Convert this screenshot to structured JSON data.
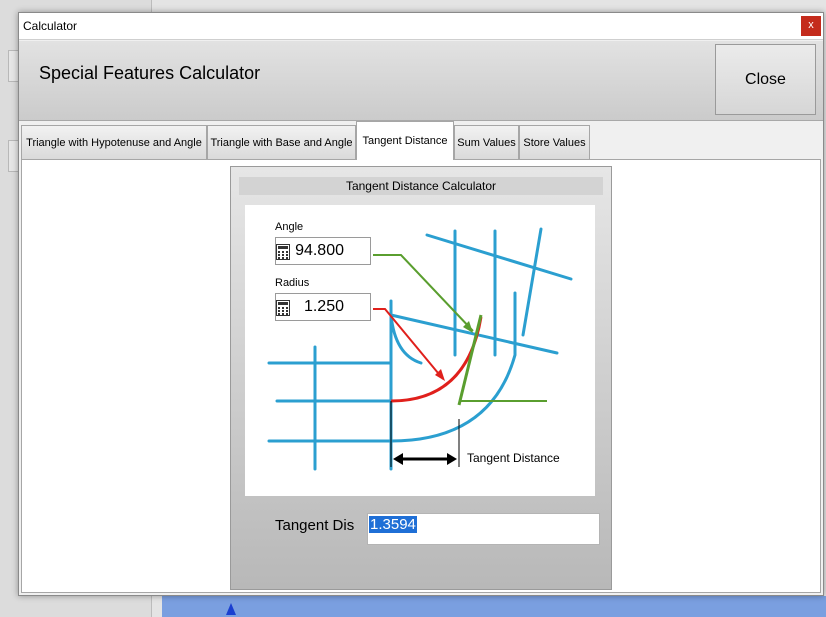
{
  "window": {
    "title": "Calculator",
    "close_glyph": "x"
  },
  "header": {
    "heading": "Special Features Calculator",
    "close_label": "Close"
  },
  "tabs": [
    {
      "label": "Triangle with Hypotenuse and Angle",
      "active": false
    },
    {
      "label": "Triangle with Base and Angle",
      "active": false
    },
    {
      "label": "Tangent Distance",
      "active": true
    },
    {
      "label": "Sum Values",
      "active": false
    },
    {
      "label": "Store Values",
      "active": false
    }
  ],
  "panel": {
    "title": "Tangent Distance Calculator",
    "angle_label": "Angle",
    "angle_value": "94.800",
    "radius_label": "Radius",
    "radius_value": "1.250",
    "diagram_caption": "Tangent Distance",
    "result_label": "Tangent Dis",
    "result_value": "1.3594"
  },
  "colors": {
    "tube": "#2b9fd0",
    "angle_arrow": "#5a9e2f",
    "radius_arc": "#e0201c",
    "result_highlight": "#1f6fd6",
    "close_red": "#c42b1c"
  },
  "icons": [
    "calculator-icon",
    "close-icon"
  ]
}
